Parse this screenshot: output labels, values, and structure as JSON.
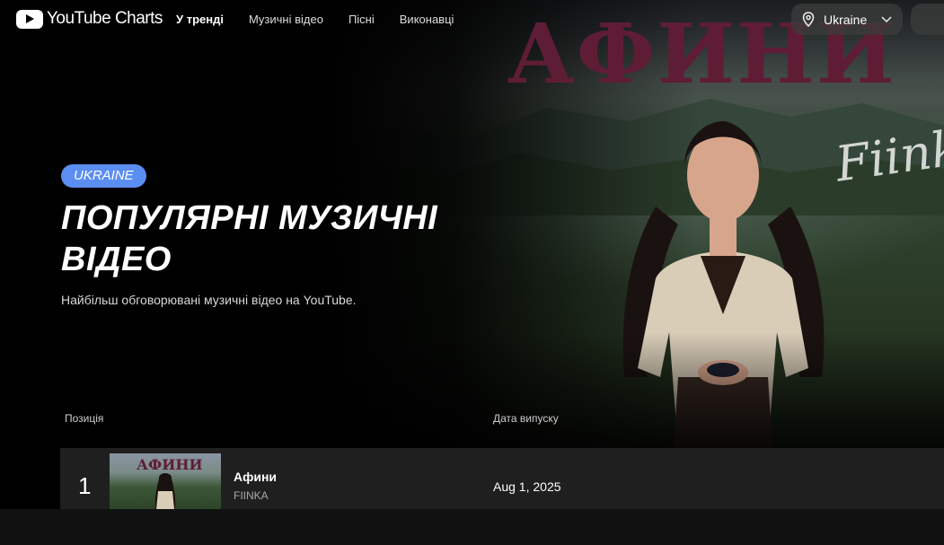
{
  "header": {
    "logo_text": "YouTube Charts",
    "nav": [
      {
        "label": "У тренді",
        "active": true
      },
      {
        "label": "Музичні відео",
        "active": false
      },
      {
        "label": "Пісні",
        "active": false
      },
      {
        "label": "Виконавці",
        "active": false
      }
    ],
    "country": "Ukraine"
  },
  "hero": {
    "badge": "UKRAINE",
    "title": "ПОПУЛЯРНІ МУЗИЧНІ ВІДЕО",
    "subtitle": "Найбільш обговорювані музичні відео на YouTube.",
    "art_title": "АФИНИ",
    "art_signature": "Fiinka"
  },
  "table": {
    "columns": {
      "position": "Позиція",
      "release_date": "Дата випуску"
    },
    "rows": [
      {
        "rank": "1",
        "title": "Афини",
        "artist": "FIINKA",
        "release_date": "Aug 1, 2025",
        "thumb_text": "АФИНИ"
      }
    ]
  },
  "colors": {
    "accent_badge": "#5b8ef1",
    "art_title": "#5e1d35",
    "row_bg": "#1f1f1f"
  },
  "icons": {
    "logo": "youtube-play-icon",
    "country": "location-pin-icon",
    "dropdown": "chevron-down-icon"
  }
}
